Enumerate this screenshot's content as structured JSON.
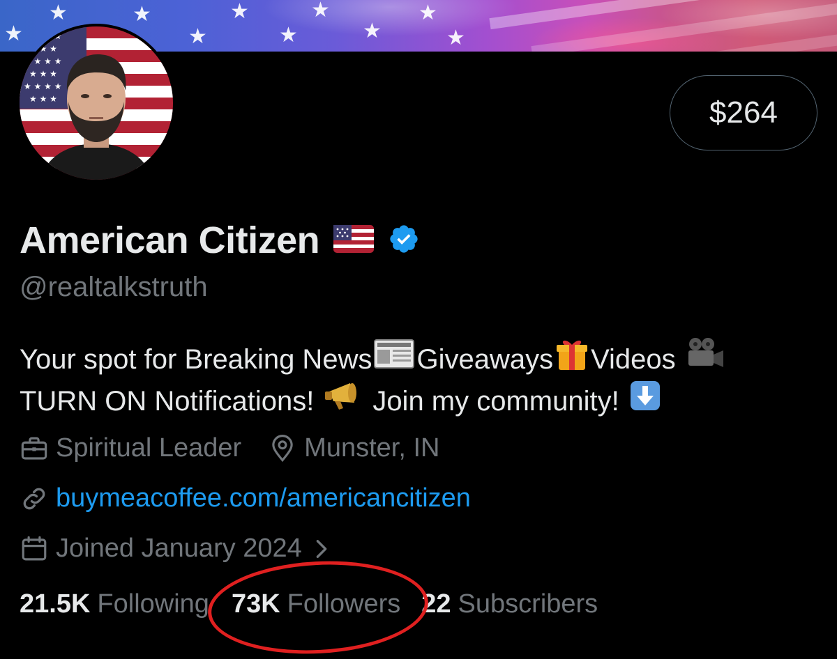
{
  "profile": {
    "display_name": "American Citizen",
    "handle": "@realtalkstruth",
    "verified": true,
    "tip_amount": "$264",
    "bio_line1": {
      "t1": "Your spot for Breaking News",
      "t2": "Giveaways",
      "t3": "Videos"
    },
    "bio_line2": {
      "t1": "TURN ON Notifications!",
      "t2": "Join my community!"
    },
    "profession": "Spiritual Leader",
    "location": "Munster, IN",
    "website": "buymeacoffee.com/americancitizen",
    "joined": "Joined January 2024"
  },
  "stats": {
    "following_count": "21.5K",
    "following_label": "Following",
    "followers_count": "73K",
    "followers_label": "Followers",
    "subscribers_count": "22",
    "subscribers_label": "Subscribers"
  },
  "icons": {
    "flag": "us-flag-emoji",
    "verified": "verified-badge-icon",
    "newspaper": "newspaper-emoji",
    "gift": "gift-emoji",
    "camera": "movie-camera-emoji",
    "megaphone": "megaphone-emoji",
    "down_arrow": "down-arrow-emoji",
    "profession": "briefcase-icon",
    "location": "location-pin-icon",
    "link": "link-icon",
    "calendar": "calendar-icon",
    "chevron": "chevron-right-icon"
  },
  "colors": {
    "background": "#000000",
    "text_primary": "#e7e9ea",
    "text_secondary": "#71767b",
    "link": "#1d9bf0",
    "verified": "#1d9bf0",
    "annotation": "#e02020"
  }
}
